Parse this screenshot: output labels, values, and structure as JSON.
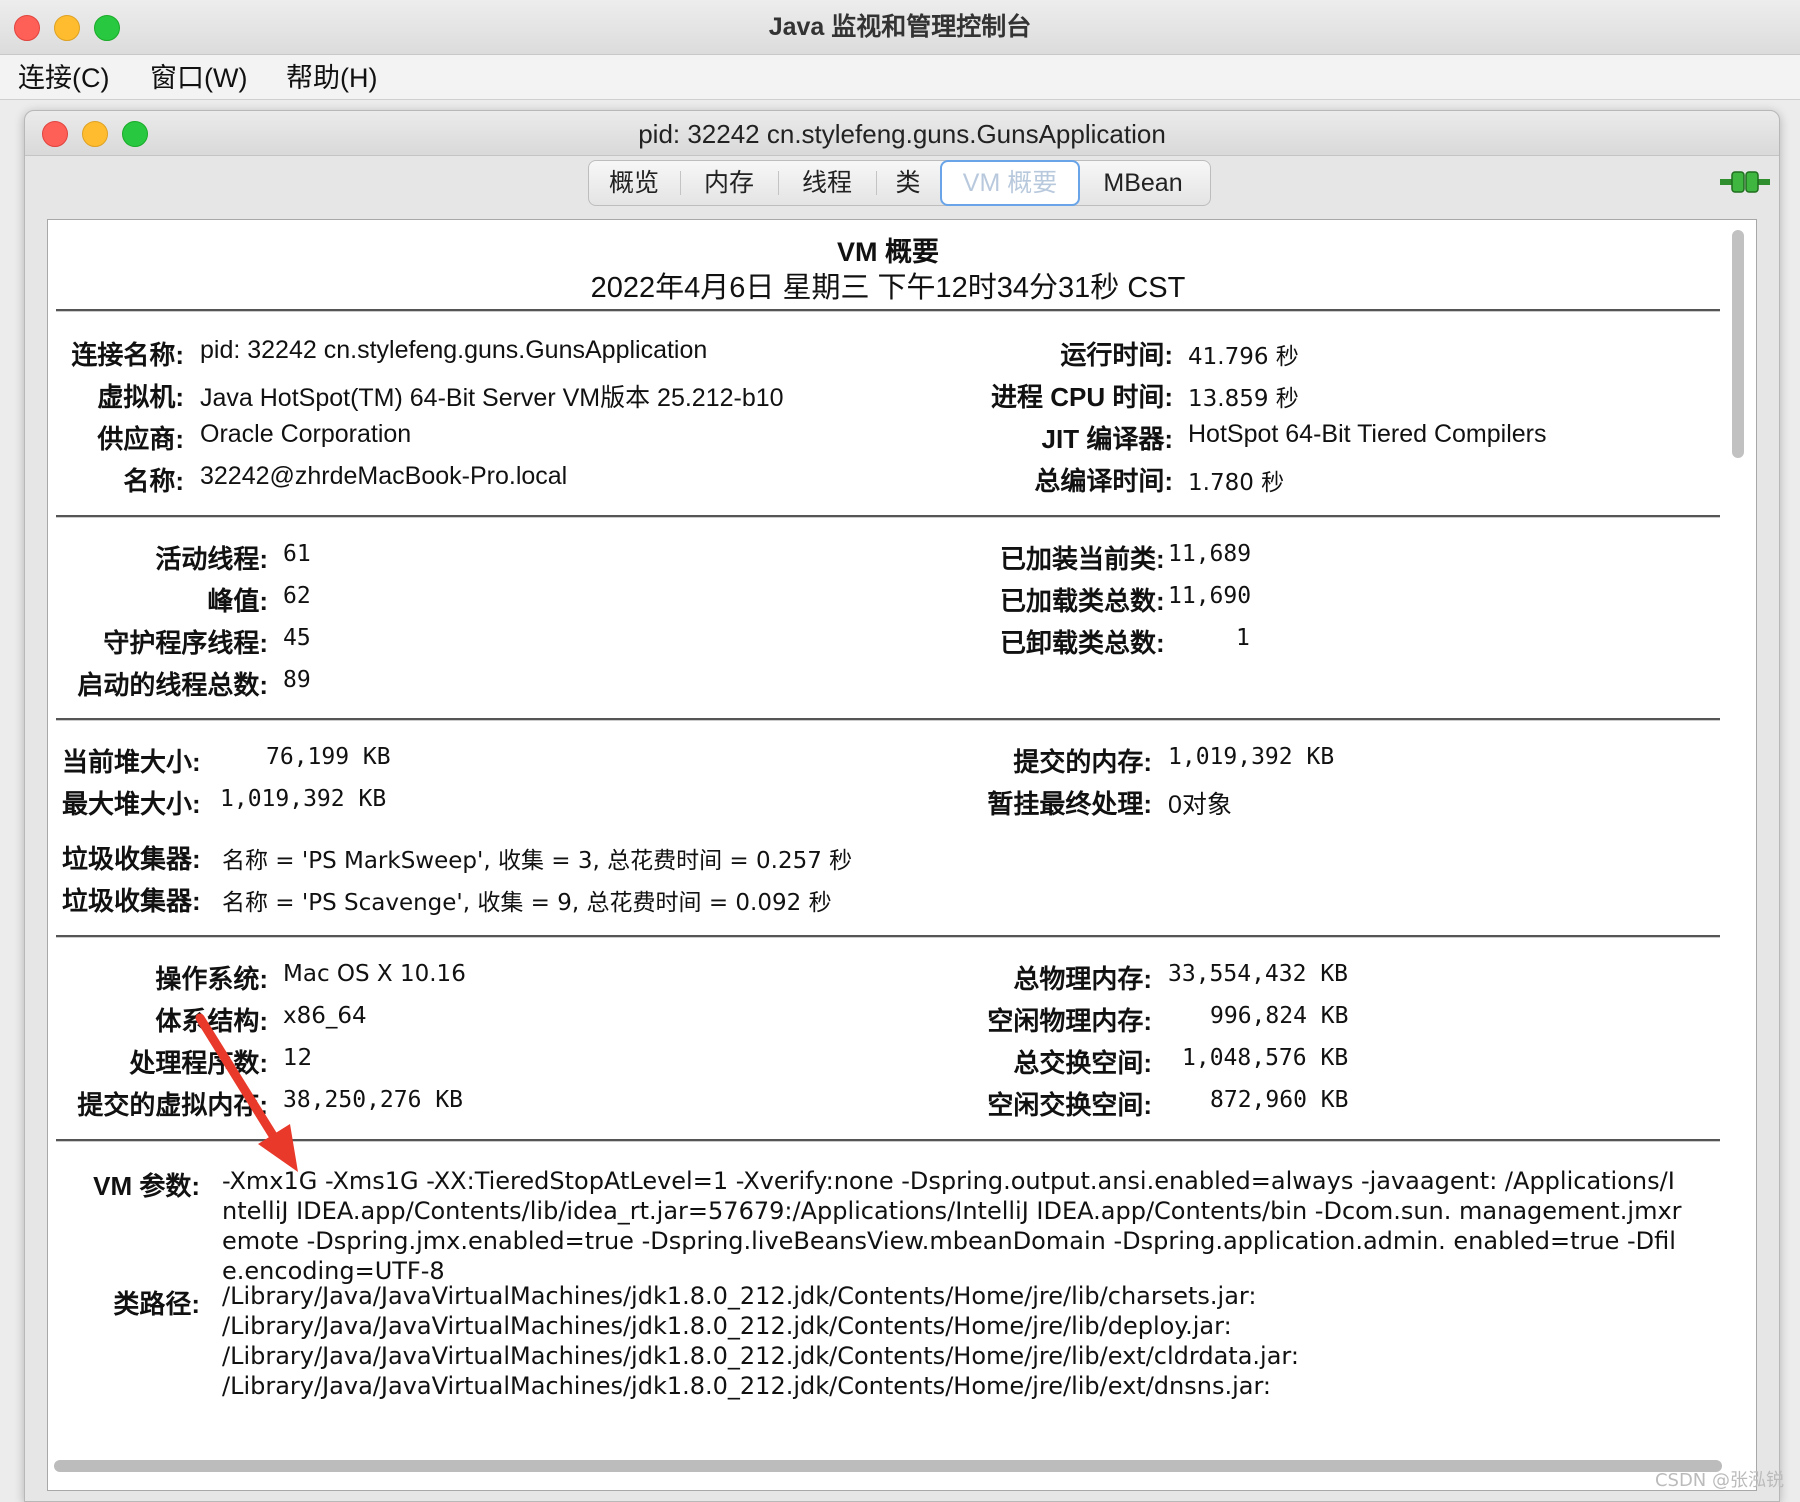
{
  "app": {
    "title": "Java 监视和管理控制台"
  },
  "menu": [
    "连接(C)",
    "窗口(W)",
    "帮助(H)"
  ],
  "window": {
    "title": "pid: 32242 cn.stylefeng.guns.GunsApplication"
  },
  "tabs": [
    "概览",
    "内存",
    "线程",
    "类",
    "VM 概要",
    "MBean"
  ],
  "active_tab": "VM 概要",
  "summary": {
    "title": "VM 概要",
    "datetime": "2022年4月6日 星期三 下午12时34分31秒 CST"
  },
  "section1": {
    "left": [
      {
        "label": "连接名称:",
        "value": "pid: 32242 cn.stylefeng.guns.GunsApplication"
      },
      {
        "label": "虚拟机:",
        "value": "Java HotSpot(TM) 64-Bit Server VM版本 25.212-b10"
      },
      {
        "label": "供应商:",
        "value": "Oracle Corporation"
      },
      {
        "label": "名称:",
        "value": "32242@zhrdeMacBook-Pro.local"
      }
    ],
    "right": [
      {
        "label": "运行时间:",
        "value": "41.796 秒"
      },
      {
        "label": "进程 CPU 时间:",
        "value": "13.859 秒"
      },
      {
        "label": "JIT 编译器:",
        "value": "HotSpot 64-Bit Tiered Compilers"
      },
      {
        "label": "总编译时间:",
        "value": "1.780 秒"
      }
    ]
  },
  "section2": {
    "left": [
      {
        "label": "活动线程:",
        "value": "61"
      },
      {
        "label": "峰值:",
        "value": "62"
      },
      {
        "label": "守护程序线程:",
        "value": "45"
      },
      {
        "label": "启动的线程总数:",
        "value": "89"
      }
    ],
    "right": [
      {
        "label": "已加装当前类:",
        "value": "11,689"
      },
      {
        "label": "已加载类总数:",
        "value": "11,690"
      },
      {
        "label": "已卸载类总数:",
        "value": "1"
      }
    ]
  },
  "section3": {
    "left": [
      {
        "label": "当前堆大小:",
        "value": "76,199 KB"
      },
      {
        "label": "最大堆大小:",
        "value": "1,019,392 KB"
      }
    ],
    "right": [
      {
        "label": "提交的内存:",
        "value": "1,019,392 KB"
      },
      {
        "label": "暂挂最终处理:",
        "value": "0对象"
      }
    ],
    "gc": [
      {
        "label": "垃圾收集器:",
        "value": "名称 = 'PS MarkSweep', 收集 = 3, 总花费时间 = 0.257 秒"
      },
      {
        "label": "垃圾收集器:",
        "value": "名称 = 'PS Scavenge', 收集 = 9, 总花费时间 = 0.092 秒"
      }
    ]
  },
  "section4": {
    "left": [
      {
        "label": "操作系统:",
        "value": "Mac OS X 10.16"
      },
      {
        "label": "体系结构:",
        "value": "x86_64"
      },
      {
        "label": "处理程序数:",
        "value": "12"
      },
      {
        "label": "提交的虚拟内存:",
        "value": "38,250,276 KB"
      }
    ],
    "right": [
      {
        "label": "总物理内存:",
        "value": "33,554,432 KB"
      },
      {
        "label": "空闲物理内存:",
        "value": "996,824 KB"
      },
      {
        "label": "总交换空间:",
        "value": "1,048,576 KB"
      },
      {
        "label": "空闲交换空间:",
        "value": "872,960 KB"
      }
    ]
  },
  "section5": {
    "vm_args_label": "VM 参数:",
    "vm_args": "-Xmx1G -Xms1G -XX:TieredStopAtLevel=1 -Xverify:none -Dspring.output.ansi.enabled=always -javaagent: /Applications/IntelliJ IDEA.app/Contents/lib/idea_rt.jar=57679:/Applications/IntelliJ IDEA.app/Contents/bin -Dcom.sun. management.jmxremote -Dspring.jmx.enabled=true -Dspring.liveBeansView.mbeanDomain -Dspring.application.admin. enabled=true -Dfile.encoding=UTF-8",
    "classpath_label": "类路径:",
    "classpath": [
      "/Library/Java/JavaVirtualMachines/jdk1.8.0_212.jdk/Contents/Home/jre/lib/charsets.jar:",
      "/Library/Java/JavaVirtualMachines/jdk1.8.0_212.jdk/Contents/Home/jre/lib/deploy.jar:",
      "/Library/Java/JavaVirtualMachines/jdk1.8.0_212.jdk/Contents/Home/jre/lib/ext/cldrdata.jar:",
      "/Library/Java/JavaVirtualMachines/jdk1.8.0_212.jdk/Contents/Home/jre/lib/ext/dnsns.jar:"
    ]
  },
  "watermark": "CSDN @张泓锐",
  "colors": {
    "accent": "#6aa4e8",
    "annotation_arrow": "#e8392a"
  }
}
